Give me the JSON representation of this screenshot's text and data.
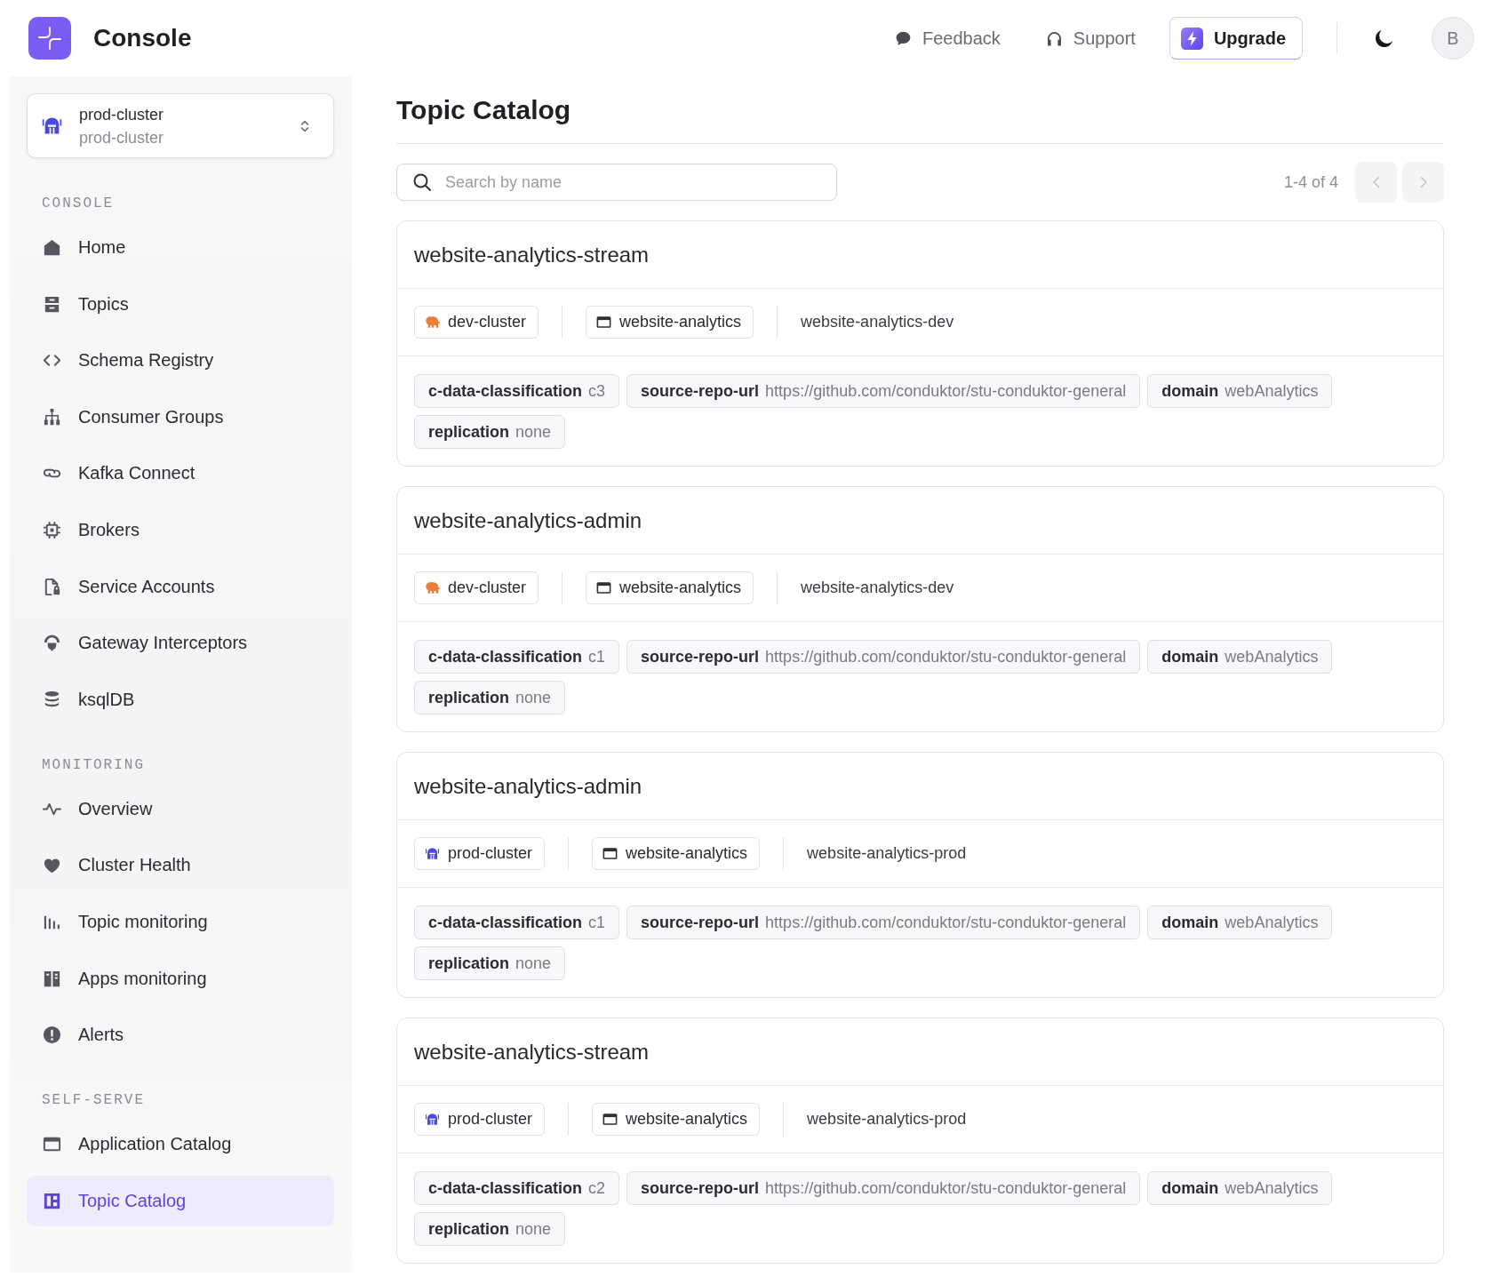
{
  "header": {
    "app_name": "Console",
    "links": [
      {
        "label": "Feedback"
      },
      {
        "label": "Support"
      }
    ],
    "upgrade": {
      "label": "Upgrade"
    },
    "avatar": {
      "initial": "B"
    }
  },
  "sidebar": {
    "cluster_selector": {
      "name": "prod-cluster",
      "subtitle": "prod-cluster",
      "kind": "helmet",
      "color": "#4b4ae0"
    },
    "sections": [
      {
        "title": "CONSOLE",
        "items": [
          {
            "label": "Home",
            "selected": false
          },
          {
            "label": "Topics",
            "selected": false
          },
          {
            "label": "Schema Registry",
            "selected": false
          },
          {
            "label": "Consumer Groups",
            "selected": false
          },
          {
            "label": "Kafka Connect",
            "selected": false
          },
          {
            "label": "Brokers",
            "selected": false
          },
          {
            "label": "Service Accounts",
            "selected": false
          },
          {
            "label": "Gateway Interceptors",
            "selected": false
          },
          {
            "label": "ksqlDB",
            "selected": false
          }
        ]
      },
      {
        "title": "MONITORING",
        "items": [
          {
            "label": "Overview",
            "selected": false
          },
          {
            "label": "Cluster Health",
            "selected": false
          },
          {
            "label": "Topic monitoring",
            "selected": false
          },
          {
            "label": "Apps monitoring",
            "selected": false
          },
          {
            "label": "Alerts",
            "selected": false
          }
        ]
      },
      {
        "title": "SELF-SERVE",
        "items": [
          {
            "label": "Application Catalog",
            "selected": false
          },
          {
            "label": "Topic Catalog",
            "selected": true
          }
        ]
      }
    ]
  },
  "page": {
    "title": "Topic Catalog",
    "search": {
      "placeholder": "Search by name"
    },
    "pagination": {
      "range": "1-4 of 4",
      "buttons": [
        {
          "kind": "prev",
          "disabled": true
        },
        {
          "kind": "next",
          "disabled": true
        }
      ]
    }
  },
  "topics": [
    {
      "name": "website-analytics-stream",
      "cluster": {
        "label": "dev-cluster",
        "kind": "elephant",
        "color": "#e8803a"
      },
      "application": "website-analytics",
      "instance": "website-analytics-dev",
      "tags": [
        {
          "key": "c-data-classification",
          "value": "c3"
        },
        {
          "key": "source-repo-url",
          "value": "https://github.com/conduktor/stu-conduktor-general"
        },
        {
          "key": "domain",
          "value": "webAnalytics"
        },
        {
          "key": "replication",
          "value": "none"
        }
      ]
    },
    {
      "name": "website-analytics-admin",
      "cluster": {
        "label": "dev-cluster",
        "kind": "elephant",
        "color": "#e8803a"
      },
      "application": "website-analytics",
      "instance": "website-analytics-dev",
      "tags": [
        {
          "key": "c-data-classification",
          "value": "c1"
        },
        {
          "key": "source-repo-url",
          "value": "https://github.com/conduktor/stu-conduktor-general"
        },
        {
          "key": "domain",
          "value": "webAnalytics"
        },
        {
          "key": "replication",
          "value": "none"
        }
      ]
    },
    {
      "name": "website-analytics-admin",
      "cluster": {
        "label": "prod-cluster",
        "kind": "helmet",
        "color": "#4b4ae0"
      },
      "application": "website-analytics",
      "instance": "website-analytics-prod",
      "tags": [
        {
          "key": "c-data-classification",
          "value": "c1"
        },
        {
          "key": "source-repo-url",
          "value": "https://github.com/conduktor/stu-conduktor-general"
        },
        {
          "key": "domain",
          "value": "webAnalytics"
        },
        {
          "key": "replication",
          "value": "none"
        }
      ]
    },
    {
      "name": "website-analytics-stream",
      "cluster": {
        "label": "prod-cluster",
        "kind": "helmet",
        "color": "#4b4ae0"
      },
      "application": "website-analytics",
      "instance": "website-analytics-prod",
      "tags": [
        {
          "key": "c-data-classification",
          "value": "c2"
        },
        {
          "key": "source-repo-url",
          "value": "https://github.com/conduktor/stu-conduktor-general"
        },
        {
          "key": "domain",
          "value": "webAnalytics"
        },
        {
          "key": "replication",
          "value": "none"
        }
      ]
    }
  ]
}
